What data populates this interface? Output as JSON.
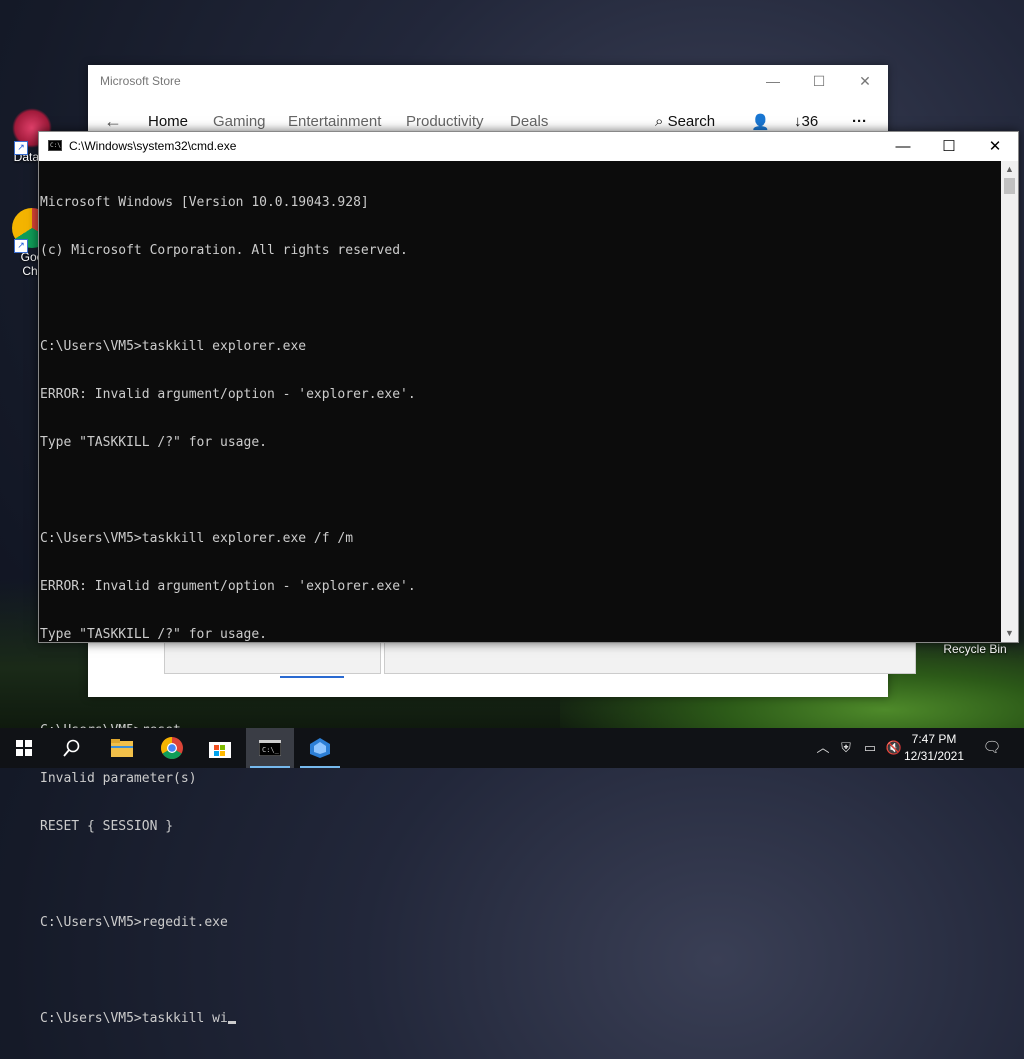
{
  "desktop": {
    "icons": [
      {
        "label": "DataW",
        "icon": "datawrapper-icon"
      },
      {
        "label": "Goo\nChr",
        "icon": "chrome-icon"
      },
      {
        "label": "Recycle Bin",
        "icon": "recycle-bin-icon"
      }
    ]
  },
  "store": {
    "title": "Microsoft Store",
    "nav": {
      "back_icon": "back-arrow-icon",
      "items": [
        "Home",
        "Gaming",
        "Entertainment",
        "Productivity",
        "Deals"
      ],
      "search_label": "Search",
      "downloads_count": "36",
      "more_label": "···"
    }
  },
  "cmd": {
    "title": "C:\\Windows\\system32\\cmd.exe",
    "lines": [
      "Microsoft Windows [Version 10.0.19043.928]",
      "(c) Microsoft Corporation. All rights reserved.",
      "",
      "C:\\Users\\VM5>taskkill explorer.exe",
      "ERROR: Invalid argument/option - 'explorer.exe'.",
      "Type \"TASKKILL /?\" for usage.",
      "",
      "C:\\Users\\VM5>taskkill explorer.exe /f /m",
      "ERROR: Invalid argument/option - 'explorer.exe'.",
      "Type \"TASKKILL /?\" for usage.",
      "",
      "C:\\Users\\VM5>reset",
      "Invalid parameter(s)",
      "RESET { SESSION }",
      "",
      "C:\\Users\\VM5>regedit.exe",
      "",
      "C:\\Users\\VM5>taskkill wi"
    ]
  },
  "taskbar": {
    "items": [
      "start-icon",
      "search-icon",
      "file-explorer-icon",
      "chrome-icon",
      "store-icon",
      "cmd-icon",
      "app-icon"
    ],
    "clock": {
      "time": "7:47 PM",
      "date": "12/31/2021"
    }
  },
  "colors": {
    "console_bg": "#0c0c0c",
    "console_fg": "#cccccc",
    "taskbar_bg": "#101216",
    "accent": "#76b9ed"
  }
}
